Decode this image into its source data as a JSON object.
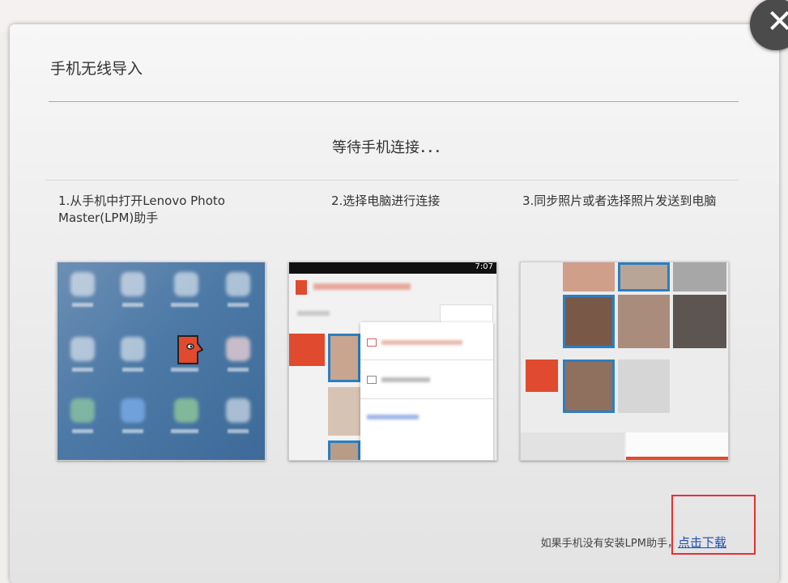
{
  "dialog": {
    "title": "手机无线导入",
    "status": "等待手机连接．．．",
    "steps": [
      {
        "label": "1.从手机中打开Lenovo Photo Master(LPM)助手"
      },
      {
        "label": "2.选择电脑进行连接"
      },
      {
        "label": "3.同步照片或者选择照片发送到电脑"
      }
    ],
    "footer": {
      "prompt": "如果手机没有安装LPM助手，",
      "download_link": "点击下载"
    },
    "phone_time": "7:07"
  },
  "colors": {
    "accent": "#e04a2f",
    "link": "#1d4fae",
    "highlight": "#e53030",
    "close_bg": "#4b4b4b"
  },
  "icons": {
    "close": "close-icon",
    "app": "lenovo-photo-master-icon"
  }
}
